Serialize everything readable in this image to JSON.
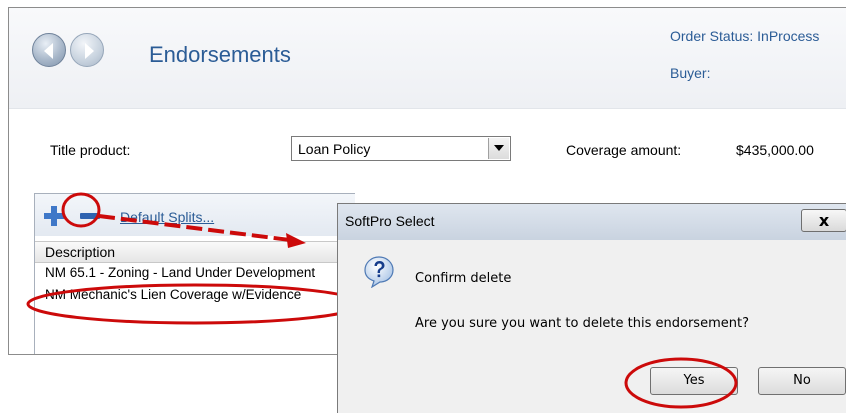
{
  "header": {
    "title": "Endorsements",
    "order_status": "Order Status: InProcess",
    "buyer": "Buyer:"
  },
  "form": {
    "title_product_label": "Title product:",
    "title_product_value": "Loan Policy",
    "coverage_label": "Coverage amount:",
    "coverage_value": "$435,000.00"
  },
  "grid": {
    "toolbar": {
      "default_splits_label": "Default Splits..."
    },
    "column_header": "Description",
    "rows": [
      {
        "description": "NM 65.1 - Zoning - Land Under Development"
      },
      {
        "description": "NM Mechanic's Lien Coverage w/Evidence"
      }
    ]
  },
  "dialog": {
    "title": "SoftPro Select",
    "close_label": "x",
    "heading": "Confirm delete",
    "message": "Are you sure you want to delete this endorsement?",
    "yes_label": "Yes",
    "no_label": "No"
  },
  "colors": {
    "accent_text": "#2b5c96",
    "annotation_red": "#cc0a0a",
    "add_icon_blue": "#3f78c8",
    "remove_icon_blue": "#2f63b0"
  },
  "icons": {
    "back": "arrow-left-circle",
    "forward": "arrow-right-circle",
    "add": "plus",
    "remove": "minus",
    "dropdown": "triangle-down",
    "question": "question-mark-bubble"
  }
}
